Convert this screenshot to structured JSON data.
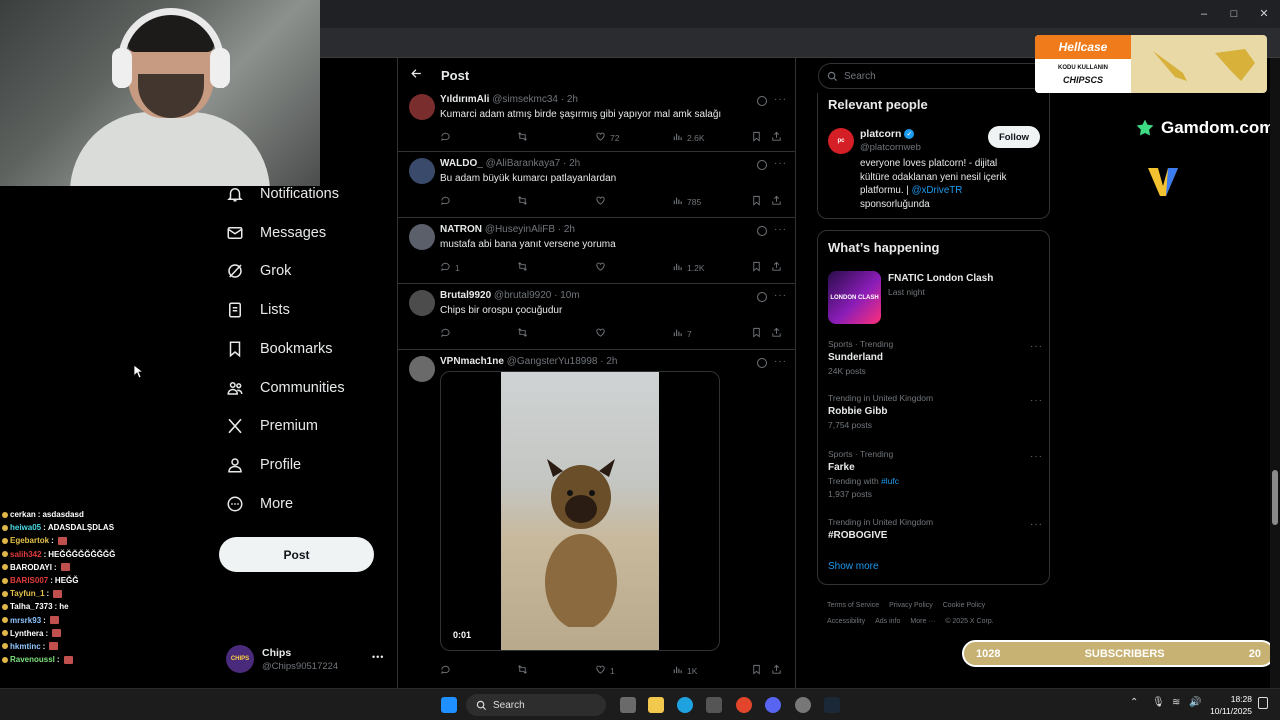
{
  "app": {
    "window_controls": [
      "–",
      "□",
      "✕"
    ]
  },
  "header": {
    "title": "Post",
    "back_icon": "arrow-left-icon"
  },
  "nav": {
    "items": [
      {
        "label": "Notifications",
        "icon": "bell-icon"
      },
      {
        "label": "Messages",
        "icon": "envelope-icon"
      },
      {
        "label": "Grok",
        "icon": "grok-icon"
      },
      {
        "label": "Lists",
        "icon": "list-icon"
      },
      {
        "label": "Bookmarks",
        "icon": "bookmark-icon"
      },
      {
        "label": "Communities",
        "icon": "people-icon"
      },
      {
        "label": "Premium",
        "icon": "x-logo-icon"
      },
      {
        "label": "Profile",
        "icon": "person-icon"
      },
      {
        "label": "More",
        "icon": "more-circle-icon"
      }
    ],
    "post_button": "Post",
    "account": {
      "name": "Chips",
      "handle": "@Chips90517224",
      "more": "•••",
      "avatar_text": "CHIPS"
    }
  },
  "tweets": [
    {
      "name": "YıldırımAli",
      "handle": "@simsekmc34",
      "time": "· 2h",
      "text": "Kumarci adam atmış birde şaşırmış gibi yapıyor mal amk salağı",
      "replies": "",
      "retweets": "",
      "likes": "72",
      "views": "2.6K"
    },
    {
      "name": "WALDO_",
      "handle": "@AliBarankaya7",
      "time": "· 2h",
      "text": "Bu adam büyük kumarcı patlayanlardan",
      "replies": "",
      "retweets": "",
      "likes": "",
      "views": "785"
    },
    {
      "name": "NATRON",
      "handle": "@HuseyinAliFB",
      "time": "· 2h",
      "text": "mustafa abi bana yanıt versene yoruma",
      "replies": "1",
      "retweets": "",
      "likes": "",
      "views": "1.2K"
    },
    {
      "name": "Brutal9920",
      "handle": "@brutal9920",
      "time": "· 10m",
      "text": "Chips bir orospu çocuğudur",
      "replies": "",
      "retweets": "",
      "likes": "",
      "views": "7"
    },
    {
      "name": "VPNmach1ne",
      "handle": "@GangsterYu18998",
      "time": "· 2h",
      "text": "",
      "replies": "",
      "retweets": "",
      "likes": "1",
      "views": "1K",
      "video_time": "0:01"
    }
  ],
  "search": {
    "placeholder": "Search"
  },
  "relevant": {
    "title": "Relevant people",
    "name": "platcorn",
    "handle": "@platcornweb",
    "follow": "Follow",
    "bio_1": "everyone loves platcorn! - dijital",
    "bio_2": "kültüre odaklanan yeni nesil içerik",
    "bio_3": "platformu. | ",
    "bio_link": "@xDriveTR",
    "bio_4": "sponsorluğunda",
    "verified_color": "#1d9bf0"
  },
  "happening": {
    "title": "What’s happening",
    "event": {
      "name": "FNATIC London Clash",
      "time": "Last night",
      "thumb_text": "LONDON CLASH"
    },
    "trends": [
      {
        "category": "Sports · Trending",
        "name": "Sunderland",
        "count": "24K posts"
      },
      {
        "category": "Trending in United Kingdom",
        "name": "Robbie Gibb",
        "count": "7,754 posts"
      },
      {
        "category": "Sports · Trending",
        "name": "Farke",
        "with_label": "Trending with ",
        "with_link": "#lufc",
        "count": "1,937 posts"
      },
      {
        "category": "Trending in United Kingdom",
        "name": "#ROBOGIVE",
        "count": ""
      }
    ],
    "show_more": "Show more"
  },
  "footer": {
    "row1": [
      "Terms of Service",
      "Privacy Policy",
      "Cookie Policy"
    ],
    "row2": [
      "Accessibility",
      "Ads info",
      "More ···",
      "© 2025 X Corp."
    ]
  },
  "overlays": {
    "hellcase_logo": "Hellcase",
    "hellcase_line1": "KODU KULLANIN",
    "hellcase_line2": "CHIPSCS",
    "gamdom": "Gamdom.com",
    "subs_current": "1028",
    "subs_label": "SUBSCRIBERS",
    "subs_goal": "20"
  },
  "chat": [
    {
      "user": "cerkan",
      "msg": "asdasdasd",
      "color": "#ffffff"
    },
    {
      "user": "heiwa05",
      "msg": "ADASDALŞDLAS",
      "color": "#4ad9e4"
    },
    {
      "user": "Egebartok",
      "msg": "",
      "color": "#e6c24a"
    },
    {
      "user": "salih342",
      "msg": "HEĞĞĞĞĞĞĞĞĞ",
      "color": "#e23b3b"
    },
    {
      "user": "BARODAYI",
      "msg": "",
      "color": "#ffffff"
    },
    {
      "user": "BARIS007",
      "msg": "HEĞĞ",
      "color": "#e23b3b"
    },
    {
      "user": "Tayfun_1",
      "msg": "",
      "color": "#e6c24a"
    },
    {
      "user": "Talha_7373",
      "msg": "he",
      "color": "#ffffff"
    },
    {
      "user": "mrsrk93",
      "msg": "",
      "color": "#8ec5ff"
    },
    {
      "user": "Lynthera",
      "msg": "",
      "color": "#ffffff"
    },
    {
      "user": "hkmtinc",
      "msg": "",
      "color": "#8ec5ff"
    },
    {
      "user": "Ravenoussl",
      "msg": "",
      "color": "#7be07b"
    }
  ],
  "taskbar": {
    "search": "Search",
    "time": "18:28",
    "date": "10/11/2025"
  },
  "colors": {
    "accent": "#1d9bf0",
    "border": "#2f3336",
    "muted": "#71767b"
  }
}
